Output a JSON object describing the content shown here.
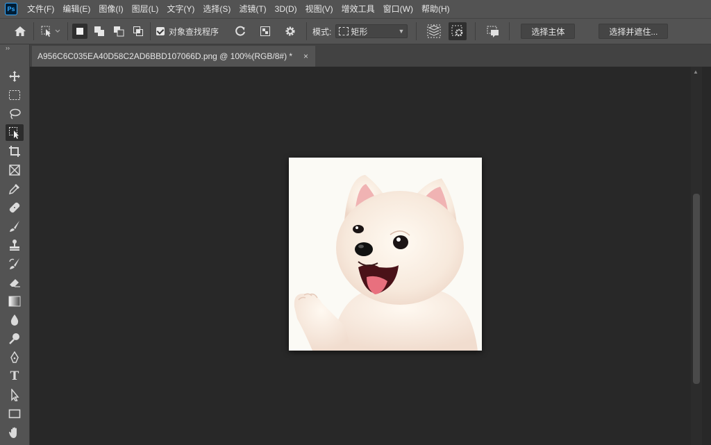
{
  "app": {
    "logo_text": "Ps"
  },
  "menu": [
    "文件(F)",
    "编辑(E)",
    "图像(I)",
    "图层(L)",
    "文字(Y)",
    "选择(S)",
    "滤镜(T)",
    "3D(D)",
    "视图(V)",
    "增效工具",
    "窗口(W)",
    "帮助(H)"
  ],
  "options": {
    "sample_all_layers_label": "对象查找程序",
    "mode_label": "模式:",
    "mode_value": "矩形",
    "select_subject_label": "选择主体",
    "select_and_mask_label": "选择并遮住..."
  },
  "toolbar": {
    "collapse_glyph": "››"
  },
  "document": {
    "tab_title": "A956C6C035EA40D58C2AD6BBD107066D.png @ 100%(RGB/8#) *",
    "close_glyph": "×",
    "image_subject": "cartoon white puppy waving"
  },
  "colors": {
    "panel": "#535353",
    "canvas": "#282828",
    "accent": "#31a8ff"
  }
}
